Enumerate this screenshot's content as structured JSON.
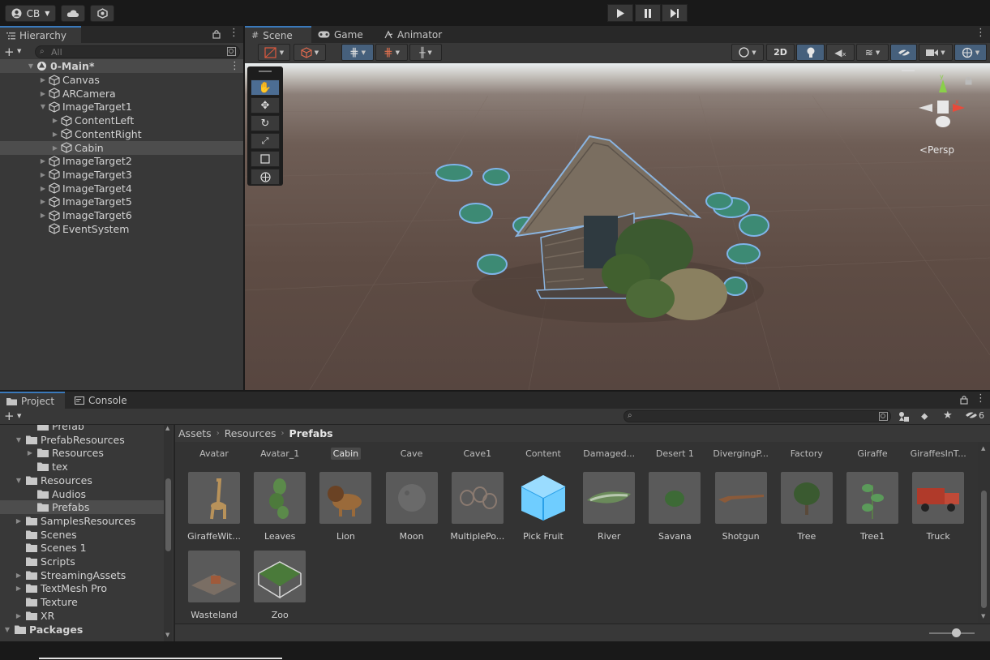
{
  "topbar": {
    "account_label": "CB",
    "play_icons": [
      "play-icon",
      "pause-icon",
      "step-icon"
    ]
  },
  "hierarchy": {
    "tab_label": "Hierarchy",
    "search_placeholder": "All",
    "scene_name": "0-Main*",
    "items": [
      {
        "label": "Canvas",
        "indent": 1,
        "expandable": true
      },
      {
        "label": "ARCamera",
        "indent": 1,
        "expandable": true
      },
      {
        "label": "ImageTarget1",
        "indent": 1,
        "expandable": true,
        "expanded": true
      },
      {
        "label": "ContentLeft",
        "indent": 2,
        "expandable": true
      },
      {
        "label": "ContentRight",
        "indent": 2,
        "expandable": true
      },
      {
        "label": "Cabin",
        "indent": 2,
        "expandable": true,
        "selected": true
      },
      {
        "label": "ImageTarget2",
        "indent": 1,
        "expandable": true
      },
      {
        "label": "ImageTarget3",
        "indent": 1,
        "expandable": true
      },
      {
        "label": "ImageTarget4",
        "indent": 1,
        "expandable": true
      },
      {
        "label": "ImageTarget5",
        "indent": 1,
        "expandable": true
      },
      {
        "label": "ImageTarget6",
        "indent": 1,
        "expandable": true
      },
      {
        "label": "EventSystem",
        "indent": 1,
        "expandable": false
      }
    ]
  },
  "scene_tabs": {
    "scene": "Scene",
    "game": "Game",
    "animator": "Animator"
  },
  "scene_toolbar": {
    "mode_2d": "2D",
    "persp_label": "<Persp"
  },
  "project": {
    "tab_project": "Project",
    "tab_console": "Console",
    "hidden_count": "6",
    "breadcrumb": [
      "Assets",
      "Resources",
      "Prefabs"
    ],
    "tree": [
      {
        "label": "Prefab",
        "indent": 2,
        "arrow": ""
      },
      {
        "label": "PrefabResources",
        "indent": 1,
        "arrow": "down"
      },
      {
        "label": "Resources",
        "indent": 2,
        "arrow": "right"
      },
      {
        "label": "tex",
        "indent": 2,
        "arrow": ""
      },
      {
        "label": "Resources",
        "indent": 1,
        "arrow": "down"
      },
      {
        "label": "Audios",
        "indent": 2,
        "arrow": ""
      },
      {
        "label": "Prefabs",
        "indent": 2,
        "arrow": "",
        "selected": true
      },
      {
        "label": "SamplesResources",
        "indent": 1,
        "arrow": "right"
      },
      {
        "label": "Scenes",
        "indent": 1,
        "arrow": ""
      },
      {
        "label": "Scenes 1",
        "indent": 1,
        "arrow": ""
      },
      {
        "label": "Scripts",
        "indent": 1,
        "arrow": ""
      },
      {
        "label": "StreamingAssets",
        "indent": 1,
        "arrow": "right"
      },
      {
        "label": "TextMesh Pro",
        "indent": 1,
        "arrow": "right"
      },
      {
        "label": "Texture",
        "indent": 1,
        "arrow": ""
      },
      {
        "label": "XR",
        "indent": 1,
        "arrow": "right"
      },
      {
        "label": "Packages",
        "indent": 0,
        "arrow": "down",
        "bold": true
      }
    ],
    "top_row": [
      "Avatar",
      "Avatar_1",
      "Cabin",
      "Cave",
      "Cave1",
      "Content",
      "Damaged...",
      "Desert 1",
      "DivergingP...",
      "Factory",
      "Giraffe",
      "GiraffesInT..."
    ],
    "assets_row1": [
      {
        "label": "GiraffeWit...",
        "icon": "giraffe-thumb"
      },
      {
        "label": "Leaves",
        "icon": "leaves-thumb"
      },
      {
        "label": "Lion",
        "icon": "lion-thumb"
      },
      {
        "label": "Moon",
        "icon": "moon-thumb"
      },
      {
        "label": "MultiplePo...",
        "icon": "multiple-thumb"
      },
      {
        "label": "Pick Fruit",
        "icon": "prefab-cube-icon"
      },
      {
        "label": "River",
        "icon": "river-thumb"
      },
      {
        "label": "Savana",
        "icon": "savana-thumb"
      },
      {
        "label": "Shotgun",
        "icon": "shotgun-thumb"
      },
      {
        "label": "Tree",
        "icon": "tree-thumb"
      },
      {
        "label": "Tree1",
        "icon": "tree1-thumb"
      },
      {
        "label": "Truck",
        "icon": "truck-thumb"
      }
    ],
    "assets_row2": [
      {
        "label": "Wasteland",
        "icon": "wasteland-thumb"
      },
      {
        "label": "Zoo",
        "icon": "zoo-thumb"
      }
    ]
  },
  "colors": {
    "accent": "#3a79bb",
    "selection": "#4d4d4d",
    "prefab_blue": "#5fc3ff"
  }
}
